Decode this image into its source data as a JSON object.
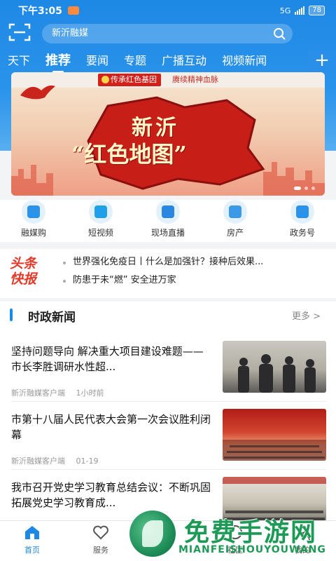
{
  "status_bar": {
    "time": "下午3:05",
    "network": "5G",
    "battery": "78"
  },
  "search": {
    "placeholder": "新沂融媒"
  },
  "tabs": [
    {
      "label": "天下"
    },
    {
      "label": "推荐",
      "active": true
    },
    {
      "label": "要闻"
    },
    {
      "label": "专题"
    },
    {
      "label": "广播互动"
    },
    {
      "label": "视频新闻"
    }
  ],
  "tab_add": "+",
  "banner": {
    "badge_text": "传承红色基因",
    "badge_text2": "赓续精神血脉",
    "title_line1": "新沂",
    "title_line2": "“红色地图”"
  },
  "quick_links": [
    {
      "label": "融媒购",
      "icon": "shopping-bag-icon"
    },
    {
      "label": "短视频",
      "icon": "video-play-icon"
    },
    {
      "label": "现场直播",
      "icon": "camera-icon"
    },
    {
      "label": "房产",
      "icon": "building-icon"
    },
    {
      "label": "政务号",
      "icon": "government-icon"
    }
  ],
  "headlines": {
    "logo_line1": "头条",
    "logo_line2": "快报",
    "items": [
      "世界强化免疫日丨什么是加强针？接种后效果...",
      "防患于未“燃” 安全进万家"
    ]
  },
  "news_section": {
    "title": "时政新闻",
    "more": "更多 >",
    "items": [
      {
        "title": "坚持问题导向 解决重大项目建设难题——市长李胜调研水性超...",
        "source": "新沂融媒客户端",
        "time": "1小时前"
      },
      {
        "title": "市第十八届人民代表大会第一次会议胜利闭幕",
        "source": "新沂融媒客户端",
        "time": "01-19"
      },
      {
        "title": "我市召开党史学习教育总结会议：不断巩固拓展党史学习教育成...",
        "source": "",
        "time": ""
      }
    ]
  },
  "bottom_nav": [
    {
      "label": "首页",
      "active": true
    },
    {
      "label": "服务"
    },
    {
      "label": "社区"
    },
    {
      "label": "我的"
    }
  ],
  "watermark": {
    "title": "免费手游网",
    "subtitle": "MIANFEISHOUYOUWANG"
  },
  "colors": {
    "primary": "#1e88e5",
    "headline_red": "#e23b2a",
    "watermark_green": "#1e9a57"
  }
}
